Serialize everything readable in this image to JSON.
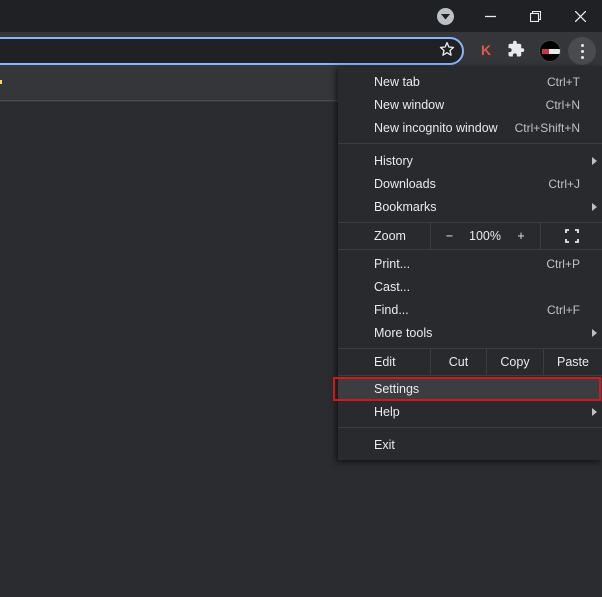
{
  "titlebar": {
    "tab_search_icon": "chevron-down-icon",
    "minimize_icon": "minimize-icon",
    "restore_icon": "restore-icon",
    "close_icon": "close-icon"
  },
  "toolbar": {
    "bookmark_icon": "star-icon",
    "extension_k_label": "K",
    "extensions_icon": "puzzle-icon",
    "menu_icon": "kebab-icon"
  },
  "menu": {
    "new_tab": {
      "label": "New tab",
      "shortcut": "Ctrl+T"
    },
    "new_window": {
      "label": "New window",
      "shortcut": "Ctrl+N"
    },
    "new_incognito": {
      "label": "New incognito window",
      "shortcut": "Ctrl+Shift+N"
    },
    "history": {
      "label": "History"
    },
    "downloads": {
      "label": "Downloads",
      "shortcut": "Ctrl+J"
    },
    "bookmarks": {
      "label": "Bookmarks"
    },
    "zoom": {
      "label": "Zoom",
      "minus": "−",
      "level": "100%",
      "plus": "+"
    },
    "print": {
      "label": "Print...",
      "shortcut": "Ctrl+P"
    },
    "cast": {
      "label": "Cast..."
    },
    "find": {
      "label": "Find...",
      "shortcut": "Ctrl+F"
    },
    "more_tools": {
      "label": "More tools"
    },
    "edit": {
      "label": "Edit",
      "cut": "Cut",
      "copy": "Copy",
      "paste": "Paste"
    },
    "settings": {
      "label": "Settings"
    },
    "help": {
      "label": "Help"
    },
    "exit": {
      "label": "Exit"
    }
  },
  "colors": {
    "highlight_border": "#d0191f",
    "omnibox_focus": "#8ab4f8",
    "menu_bg": "#292a2d"
  }
}
